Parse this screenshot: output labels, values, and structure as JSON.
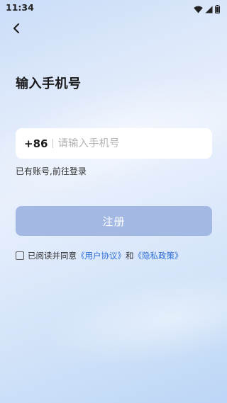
{
  "status_bar": {
    "time": "11:34",
    "icons": [
      "wifi-icon",
      "signal-icon",
      "battery-icon"
    ]
  },
  "header": {
    "back_icon": "chevron-left-icon",
    "title": "输入手机号"
  },
  "phone_field": {
    "country_code": "+86",
    "placeholder": "请输入手机号",
    "value": ""
  },
  "login_link": "已有账号,前往登录",
  "register_button": {
    "label": "注册",
    "enabled": false
  },
  "agreement": {
    "checked": false,
    "prefix": "已阅读并同意",
    "user_agreement": "《用户协议》",
    "conjunction": "和",
    "privacy_policy": "《隐私政策》"
  },
  "colors": {
    "link": "#2f6fd6",
    "button_disabled": "#a3b8e3"
  }
}
